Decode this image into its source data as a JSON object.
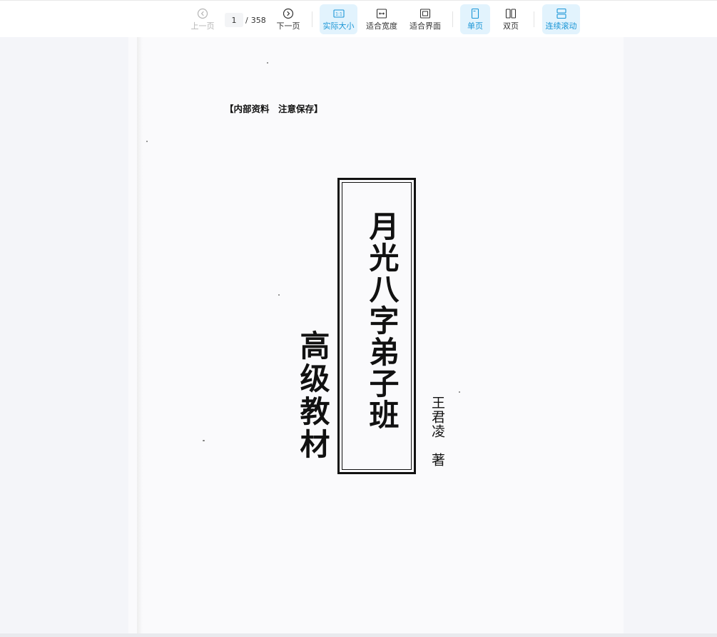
{
  "toolbar": {
    "prev_label": "上一页",
    "next_label": "下一页",
    "current_page": "1",
    "total_pages": "358",
    "page_separator": "/",
    "actual_size_label": "实际大小",
    "actual_size_icon_text": "1:1",
    "fit_width_label": "适合宽度",
    "fit_page_label": "适合界面",
    "single_page_label": "单页",
    "double_page_label": "双页",
    "continuous_scroll_label": "连续滚动",
    "active_items": [
      "actual-size",
      "single-page",
      "continuous-scroll"
    ],
    "disabled_items": [
      "prev-page"
    ],
    "accent_color": "#1a96d6",
    "active_bg": "#e2f3fd"
  },
  "document": {
    "notice": "【内部资料　注意保存】",
    "title": "月光八字弟子班",
    "subtitle": "高级教材",
    "author": "王君凌　著"
  }
}
